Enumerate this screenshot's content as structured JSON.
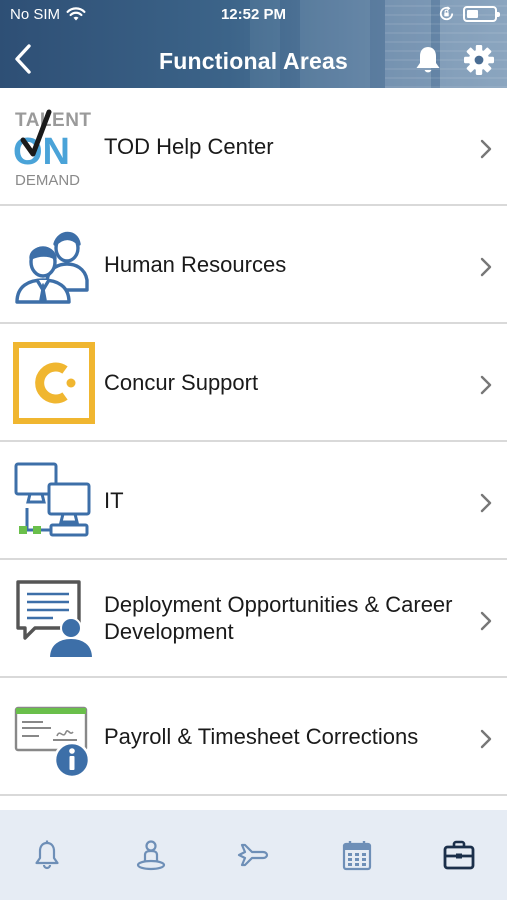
{
  "status_bar": {
    "carrier": "No SIM",
    "time": "12:52 PM"
  },
  "nav": {
    "title": "Functional Areas",
    "back_icon": "chevron-left-icon",
    "icons": [
      "bell-icon",
      "gear-icon"
    ]
  },
  "talent_logo": {
    "line1": "TALENT",
    "line2": "ON",
    "line3": "DEMAND"
  },
  "items": [
    {
      "label": "TOD Help Center",
      "icon": "talent-on-demand-logo"
    },
    {
      "label": "Human Resources",
      "icon": "people-icon"
    },
    {
      "label": "Concur Support",
      "icon": "concur-logo"
    },
    {
      "label": "IT",
      "icon": "computers-network-icon"
    },
    {
      "label": "Deployment Opportunities & Career Development",
      "icon": "presentation-person-icon"
    },
    {
      "label": "Payroll & Timesheet Corrections",
      "icon": "check-info-icon"
    }
  ],
  "tabs": [
    {
      "name": "notifications",
      "icon": "bell-icon",
      "active": false
    },
    {
      "name": "location",
      "icon": "location-person-icon",
      "active": false
    },
    {
      "name": "travel",
      "icon": "airplane-icon",
      "active": false
    },
    {
      "name": "calendar",
      "icon": "calendar-icon",
      "active": false
    },
    {
      "name": "functional-areas",
      "icon": "briefcase-icon",
      "active": true
    }
  ],
  "colors": {
    "header_bg": "#3c6489",
    "tab_bar_bg": "#e6ecf4",
    "tab_icon": "#6e8fb7",
    "tab_icon_active": "#1b2f4a",
    "icon_blue": "#3d6fa8",
    "concur_yellow": "#f0b630",
    "divider": "#d9d9d9"
  }
}
